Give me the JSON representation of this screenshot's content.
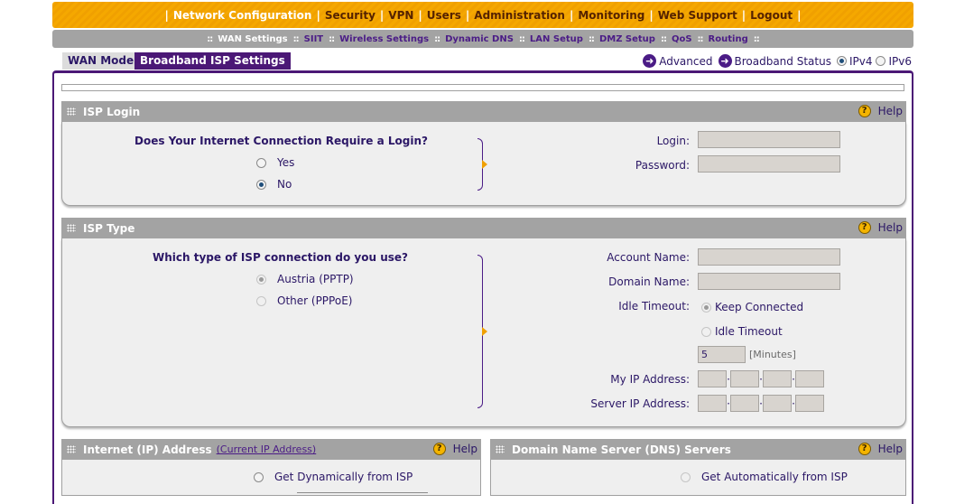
{
  "topnav": {
    "items": [
      {
        "label": "Network Configuration",
        "active": true
      },
      {
        "label": "Security"
      },
      {
        "label": "VPN"
      },
      {
        "label": "Users"
      },
      {
        "label": "Administration"
      },
      {
        "label": "Monitoring"
      },
      {
        "label": "Web Support"
      },
      {
        "label": "Logout"
      }
    ],
    "separator": "|"
  },
  "subnav": {
    "separator": "::",
    "items": [
      {
        "label": "WAN Settings",
        "active": true
      },
      {
        "label": "SIIT"
      },
      {
        "label": "Wireless Settings"
      },
      {
        "label": "Dynamic DNS"
      },
      {
        "label": "LAN Setup"
      },
      {
        "label": "DMZ Setup"
      },
      {
        "label": "QoS"
      },
      {
        "label": "Routing"
      }
    ]
  },
  "tabs": {
    "wan_mode": "WAN Mode",
    "broadband": "Broadband ISP Settings"
  },
  "right_links": {
    "advanced": "Advanced",
    "broadband_status": "Broadband Status",
    "ipv4": "IPv4",
    "ipv6": "IPv6",
    "ip_version_selected": "IPv4"
  },
  "help_label": "Help",
  "help_icon_glyph": "?",
  "arrow_glyph": "➜",
  "isp_login": {
    "title": "ISP Login",
    "question": "Does Your Internet Connection Require a Login?",
    "yes": "Yes",
    "no": "No",
    "selected": "No",
    "login_label": "Login:",
    "password_label": "Password:",
    "login_value": "",
    "password_value": ""
  },
  "isp_type": {
    "title": "ISP Type",
    "question": "Which type of ISP connection do you use?",
    "austria": "Austria (PPTP)",
    "other": "Other (PPPoE)",
    "account_name_label": "Account Name:",
    "domain_name_label": "Domain Name:",
    "idle_timeout_label": "Idle Timeout:",
    "keep_connected": "Keep Connected",
    "idle_timeout_option": "Idle Timeout",
    "idle_minutes_value": "5",
    "minutes_unit": "[Minutes]",
    "my_ip_label": "My IP Address:",
    "server_ip_label": "Server IP Address:"
  },
  "internet_ip": {
    "title": "Internet (IP) Address",
    "link": "(Current IP Address)",
    "get_dynamic": "Get Dynamically from ISP"
  },
  "dns": {
    "title": "Domain Name Server (DNS) Servers",
    "get_auto": "Get Automatically from ISP"
  },
  "colors": {
    "orange_nav": "#f5a800",
    "gray_nav": "#a3a3a3",
    "purple": "#4b1876"
  }
}
